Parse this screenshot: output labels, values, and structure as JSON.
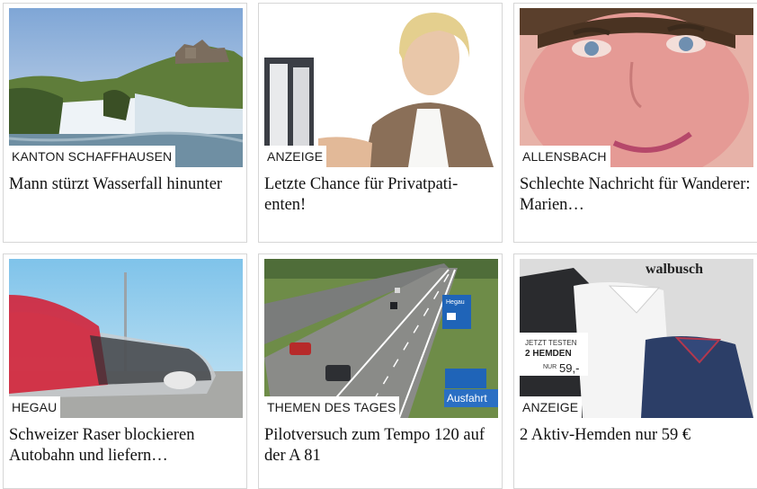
{
  "cards": [
    {
      "tag": "KANTON SCHAFFHAUSEN",
      "title": "Mann stürzt Wasserfall hinunter",
      "image_icon": "waterfall-castle-photo"
    },
    {
      "tag": "ANZEIGE",
      "title": "Letzte Chance für Privatpati-enten!",
      "image_icon": "businesswoman-photo"
    },
    {
      "tag": "ALLENSBACH",
      "title": "Schlechte Nachricht für Wanderer: Marien…",
      "image_icon": "man-portrait-photo"
    },
    {
      "tag": "HEGAU",
      "title": "Schweizer Raser blockieren Autobahn und liefern…",
      "image_icon": "speeding-car-photo"
    },
    {
      "tag": "THEMEN DES TAGES",
      "title": "Pilotversuch zum Tempo 120 auf der A 81",
      "image_icon": "highway-photo",
      "signs": {
        "exit": "Ausfahrt",
        "hegau": "Hegau"
      }
    },
    {
      "tag": "ANZEIGE",
      "title": "2 Aktiv-Hemden nur 59 €",
      "image_icon": "shirts-ad-photo",
      "ad": {
        "brand": "walbusch",
        "line1": "JETZT TESTEN",
        "line2": "2 HEMDEN",
        "price_prefix": "NUR",
        "price": "59,-"
      }
    }
  ],
  "colors": {
    "border": "#d6d6d6",
    "text": "#111111",
    "tag_bg": "#ffffff"
  }
}
